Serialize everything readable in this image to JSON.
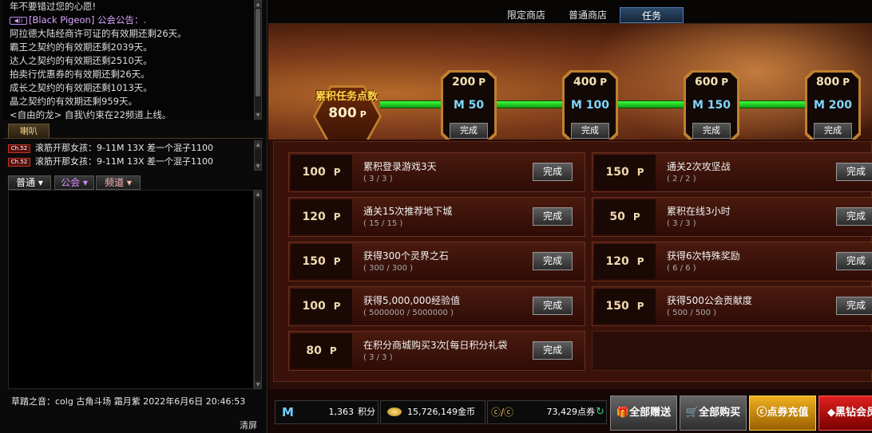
{
  "chat": {
    "log": [
      {
        "text": "年不要错过您的心愿!",
        "style": "normal"
      },
      {
        "text": "[Black Pigeon] 公会公告：.",
        "style": "purple",
        "icon": "speaker-icon"
      },
      {
        "text": "阿拉德大陆经商许可证的有效期还剩26天。",
        "style": "normal"
      },
      {
        "text": "霸王之契约的有效期还剩2039天。",
        "style": "normal"
      },
      {
        "text": "达人之契约的有效期还剩2510天。",
        "style": "normal"
      },
      {
        "text": "拍卖行优惠券的有效期还剩26天。",
        "style": "normal"
      },
      {
        "text": "成长之契约的有效期还剩1013天。",
        "style": "normal"
      },
      {
        "text": "晶之契约的有效期还剩959天。",
        "style": "normal"
      },
      {
        "text": "<自由的龙> 自我\\约束在22频道上线。",
        "style": "normal"
      }
    ],
    "horn_tab": "喇叭",
    "horn_messages": [
      {
        "badge": "Ch.52",
        "text": "滚筋开那女孩：9-11M 13X 差一个混子1100"
      },
      {
        "badge": "Ch.52",
        "text": "滚筋开那女孩：9-11M 13X 差一个混子1100"
      }
    ],
    "tabs": [
      {
        "label": "普通 ▾",
        "color": "#ffffff"
      },
      {
        "label": "公会 ▾",
        "color": "#d68cff"
      },
      {
        "label": "频道 ▾",
        "color": "#ffb8b8"
      }
    ],
    "footer_message": "草踏之音：colg 古角斗场 霜月紫 2022年6月6日 20:46:53",
    "clear_label": "清屏"
  },
  "nav": {
    "tabs": [
      {
        "label": "限定商店",
        "active": false
      },
      {
        "label": "普通商店",
        "active": false
      },
      {
        "label": "任务",
        "active": true
      }
    ]
  },
  "progress": {
    "label": "累积任务点数",
    "value": "800",
    "unit": "P",
    "milestones": [
      {
        "points": "200",
        "unit": "P",
        "reward": "M 50",
        "button": "完成"
      },
      {
        "points": "400",
        "unit": "P",
        "reward": "M 100",
        "button": "完成"
      },
      {
        "points": "600",
        "unit": "P",
        "reward": "M 150",
        "button": "完成"
      },
      {
        "points": "800",
        "unit": "P",
        "reward": "M 200",
        "button": "完成"
      }
    ]
  },
  "tasks": [
    {
      "points": "100",
      "unit": "P",
      "name": "累积登录游戏3天",
      "progress": "( 3 / 3 )",
      "button": "完成"
    },
    {
      "points": "150",
      "unit": "P",
      "name": "通关2次攻坚战",
      "progress": "( 2 / 2 )",
      "button": "完成"
    },
    {
      "points": "120",
      "unit": "P",
      "name": "通关15次推荐地下城",
      "progress": "( 15 / 15 )",
      "button": "完成"
    },
    {
      "points": "50",
      "unit": "P",
      "name": "累积在线3小时",
      "progress": "( 3 / 3 )",
      "button": "完成"
    },
    {
      "points": "150",
      "unit": "P",
      "name": "获得300个灵界之石",
      "progress": "( 300 / 300 )",
      "button": "完成"
    },
    {
      "points": "120",
      "unit": "P",
      "name": "获得6次特殊奖励",
      "progress": "( 6 / 6 )",
      "button": "完成"
    },
    {
      "points": "100",
      "unit": "P",
      "name": "获得5,000,000经验值",
      "progress": "( 5000000 / 5000000 )",
      "button": "完成"
    },
    {
      "points": "150",
      "unit": "P",
      "name": "获得500公会贡献度",
      "progress": "( 500 / 500 )",
      "button": "完成"
    },
    {
      "points": "80",
      "unit": "P",
      "name": "在积分商城购买3次[每日积分礼袋",
      "progress": "( 3 / 3 )",
      "button": "完成"
    }
  ],
  "currency": {
    "m_icon": "M",
    "points_value": "1,363",
    "points_label": "积分",
    "gold_value": "15,726,149金币",
    "coupon_value": "73,429点券",
    "coupon_icon": "ⓒ/ⓒ"
  },
  "actions": {
    "gift_all": "全部赠送",
    "buy_all": "全部购买",
    "recharge": "点券充值",
    "diamond": "黑钻会员"
  }
}
